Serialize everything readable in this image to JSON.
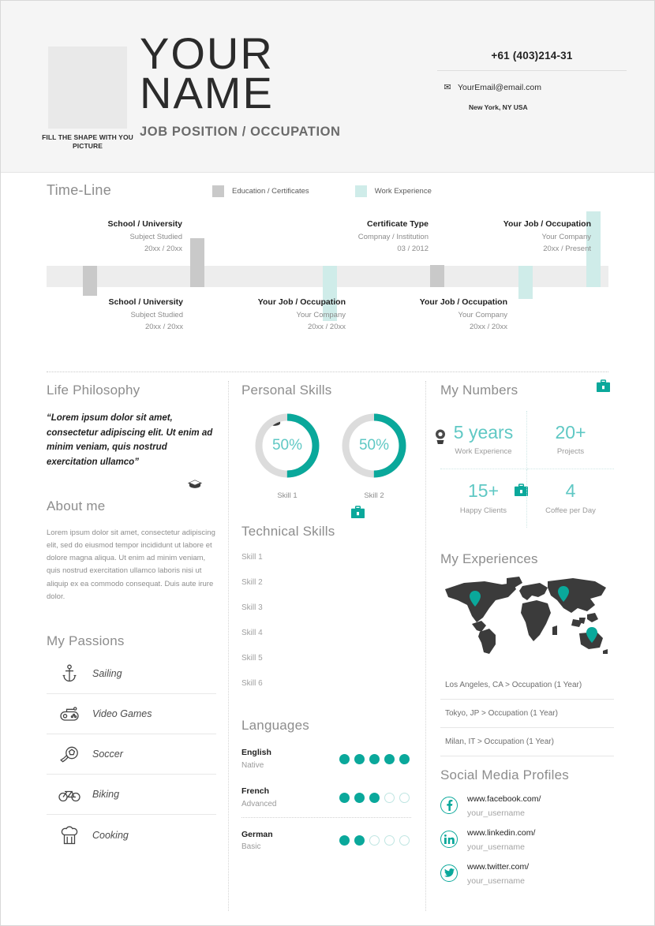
{
  "colors": {
    "accent_teal": "#0aa89b",
    "accent_light_teal": "#5fc8c4",
    "work_bar": "#cfece9",
    "education_bar": "#c9c9c9",
    "track": "#ededed",
    "header_bg": "#f5f5f5"
  },
  "header": {
    "photo_caption": "FILL THE SHAPE WITH YOU PICTURE",
    "name_line1": "YOUR",
    "name_line2": "NAME",
    "job_position": "JOB POSITION / OCCUPATION",
    "phone": "+61 (403)214-31",
    "email": "YourEmail@email.com",
    "location": "New York, NY USA",
    "email_icon": "envelope-icon"
  },
  "timeline": {
    "title": "Time-Line",
    "legend": [
      {
        "label": "Education / Certificates",
        "color": "#c9c9c9"
      },
      {
        "label": "Work Experience",
        "color": "#cfece9"
      }
    ],
    "entries": [
      {
        "title": "School / University",
        "sub1": "Subject Studied",
        "sub2": "20xx / 20xx",
        "icon": "graduation-cap-icon",
        "side": "below",
        "type": "education"
      },
      {
        "title": "School / University",
        "sub1": "Subject Studied",
        "sub2": "20xx / 20xx",
        "icon": "graduation-cap-icon",
        "side": "above",
        "type": "education"
      },
      {
        "title": "Your Job / Occupation",
        "sub1": "Your Company",
        "sub2": "20xx / 20xx",
        "icon": "briefcase-icon",
        "side": "below",
        "type": "work"
      },
      {
        "title": "Certificate Type",
        "sub1": "Compnay / Institution",
        "sub2": "03 / 2012",
        "icon": "award-medal-icon",
        "side": "above",
        "type": "education"
      },
      {
        "title": "Your Job / Occupation",
        "sub1": "Your Company",
        "sub2": "20xx / 20xx",
        "icon": "briefcase-icon",
        "side": "below",
        "type": "work"
      },
      {
        "title": "Your Job / Occupation",
        "sub1": "Your Company",
        "sub2": "20xx / Present",
        "icon": "briefcase-icon",
        "side": "above",
        "type": "work"
      }
    ]
  },
  "life_philosophy": {
    "title": "Life Philosophy",
    "quote": "“Lorem ipsum dolor sit amet, consectetur adipiscing elit. Ut enim ad minim veniam, quis nostrud exercitation ullamco”"
  },
  "about_me": {
    "title": "About me",
    "text": "Lorem ipsum dolor sit amet, consectetur adipiscing elit, sed do eiusmod tempor incididunt ut labore et dolore magna aliqua. Ut enim ad minim veniam, quis nostrud exercitation ullamco laboris nisi ut aliquip ex ea commodo consequat. Duis aute irure dolor."
  },
  "passions": {
    "title": "My Passions",
    "items": [
      {
        "label": "Sailing",
        "icon": "anchor-icon"
      },
      {
        "label": "Video Games",
        "icon": "gamepad-icon"
      },
      {
        "label": "Soccer",
        "icon": "soccer-ball-icon"
      },
      {
        "label": "Biking",
        "icon": "bicycle-icon"
      },
      {
        "label": "Cooking",
        "icon": "chef-hat-icon"
      }
    ]
  },
  "personal_skills": {
    "title": "Personal Skills",
    "items": [
      {
        "label": "Skill 1",
        "value": "50%",
        "percent": 50
      },
      {
        "label": "Skill 2",
        "value": "50%",
        "percent": 50
      }
    ]
  },
  "technical_skills": {
    "title": "Technical Skills",
    "items": [
      "Skill 1",
      "Skill 2",
      "Skill 3",
      "Skill 4",
      "Skill 5",
      "Skill 6"
    ]
  },
  "languages": {
    "title": "Languages",
    "items": [
      {
        "name": "English",
        "level": "Native",
        "filled": 5,
        "total": 5
      },
      {
        "name": "French",
        "level": "Advanced",
        "filled": 3,
        "total": 5
      },
      {
        "name": "German",
        "level": "Basic",
        "filled": 2,
        "total": 5
      }
    ]
  },
  "my_numbers": {
    "title": "My Numbers",
    "items": [
      {
        "value": "5 years",
        "label": "Work Experience"
      },
      {
        "value": "20+",
        "label": "Projects"
      },
      {
        "value": "15+",
        "label": "Happy Clients"
      },
      {
        "value": "4",
        "label": "Coffee per Day"
      }
    ]
  },
  "experiences": {
    "title": "My Experiences",
    "map_icon": "world-map",
    "pins": [
      "map-pin-north-america",
      "map-pin-asia",
      "map-pin-australia"
    ],
    "items": [
      "Los Angeles, CA > Occupation (1 Year)",
      "Tokyo, JP > Occupation (1 Year)",
      "Milan, IT > Occupation (1 Year)"
    ]
  },
  "social": {
    "title": "Social Media Profiles",
    "items": [
      {
        "icon": "facebook-icon",
        "url": "www.facebook.com/",
        "username": "your_username"
      },
      {
        "icon": "linkedin-icon",
        "url": "www.linkedin.com/",
        "username": "your_username"
      },
      {
        "icon": "twitter-icon",
        "url": "www.twitter.com/",
        "username": "your_username"
      }
    ]
  }
}
